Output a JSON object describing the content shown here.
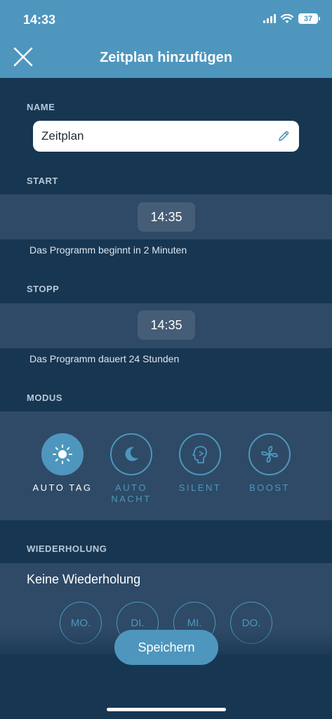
{
  "status_bar": {
    "time": "14:33",
    "battery": "37"
  },
  "header": {
    "title": "Zeitplan hinzufügen"
  },
  "name": {
    "label": "NAME",
    "value": "Zeitplan"
  },
  "start": {
    "label": "START",
    "time": "14:35",
    "info": "Das Programm beginnt in 2 Minuten"
  },
  "stop": {
    "label": "STOPP",
    "time": "14:35",
    "info": "Das Programm dauert 24 Stunden"
  },
  "mode": {
    "label": "MODUS",
    "options": [
      {
        "label": "AUTO TAG",
        "icon": "sun-icon",
        "active": true
      },
      {
        "label": "AUTO NACHT",
        "icon": "moon-icon",
        "active": false
      },
      {
        "label": "SILENT",
        "icon": "silent-icon",
        "active": false
      },
      {
        "label": "BOOST",
        "icon": "fan-icon",
        "active": false
      }
    ]
  },
  "repeat": {
    "label": "WIEDERHOLUNG",
    "value": "Keine Wiederholung",
    "days": [
      "MO.",
      "DI.",
      "MI.",
      "DO."
    ]
  },
  "save_button": "Speichern",
  "colors": {
    "accent": "#4e96bd",
    "background": "#173652",
    "band": "#2e4a66"
  }
}
